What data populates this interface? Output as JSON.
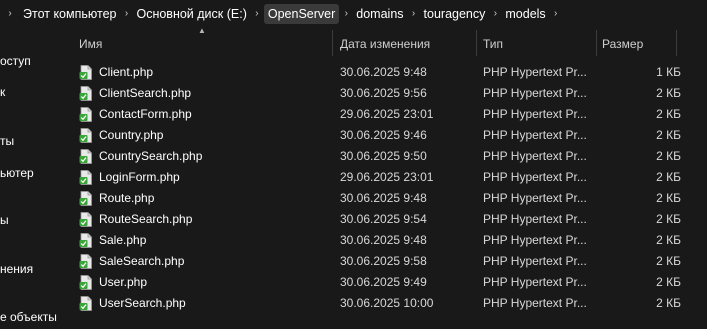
{
  "breadcrumb": {
    "items": [
      {
        "label": "Этот компьютер",
        "active": false
      },
      {
        "label": "Основной диск (E:)",
        "active": false
      },
      {
        "label": "OpenServer",
        "active": true
      },
      {
        "label": "domains",
        "active": false
      },
      {
        "label": "touragency",
        "active": false
      },
      {
        "label": "models",
        "active": false
      }
    ]
  },
  "sidebar": {
    "items": [
      {
        "label": "оступ"
      },
      {
        "label": "к"
      },
      {
        "label": "ты"
      },
      {
        "label": "ьютер"
      },
      {
        "label": "ы"
      },
      {
        "label": "нения"
      },
      {
        "label": "е объекты"
      }
    ]
  },
  "columns": {
    "name": "Имя",
    "date": "Дата изменения",
    "type": "Тип",
    "size": "Размер"
  },
  "files": [
    {
      "name": "Client.php",
      "date": "30.06.2025 9:48",
      "type": "PHP Hypertext Pr...",
      "size": "1 КБ"
    },
    {
      "name": "ClientSearch.php",
      "date": "30.06.2025 9:56",
      "type": "PHP Hypertext Pr...",
      "size": "2 КБ"
    },
    {
      "name": "ContactForm.php",
      "date": "29.06.2025 23:01",
      "type": "PHP Hypertext Pr...",
      "size": "2 КБ"
    },
    {
      "name": "Country.php",
      "date": "30.06.2025 9:46",
      "type": "PHP Hypertext Pr...",
      "size": "2 КБ"
    },
    {
      "name": "CountrySearch.php",
      "date": "30.06.2025 9:50",
      "type": "PHP Hypertext Pr...",
      "size": "2 КБ"
    },
    {
      "name": "LoginForm.php",
      "date": "29.06.2025 23:01",
      "type": "PHP Hypertext Pr...",
      "size": "2 КБ"
    },
    {
      "name": "Route.php",
      "date": "30.06.2025 9:48",
      "type": "PHP Hypertext Pr...",
      "size": "2 КБ"
    },
    {
      "name": "RouteSearch.php",
      "date": "30.06.2025 9:54",
      "type": "PHP Hypertext Pr...",
      "size": "2 КБ"
    },
    {
      "name": "Sale.php",
      "date": "30.06.2025 9:48",
      "type": "PHP Hypertext Pr...",
      "size": "2 КБ"
    },
    {
      "name": "SaleSearch.php",
      "date": "30.06.2025 9:58",
      "type": "PHP Hypertext Pr...",
      "size": "2 КБ"
    },
    {
      "name": "User.php",
      "date": "30.06.2025 9:49",
      "type": "PHP Hypertext Pr...",
      "size": "2 КБ"
    },
    {
      "name": "UserSearch.php",
      "date": "30.06.2025 10:00",
      "type": "PHP Hypertext Pr...",
      "size": "2 КБ"
    }
  ],
  "icons": {
    "file": "php-file-icon",
    "separator": "chevron-right-icon",
    "sort": "sort-ascending-icon"
  },
  "colors": {
    "background": "#191919",
    "active_crumb": "#3a3a3a",
    "icon_green": "#3aa63a"
  }
}
